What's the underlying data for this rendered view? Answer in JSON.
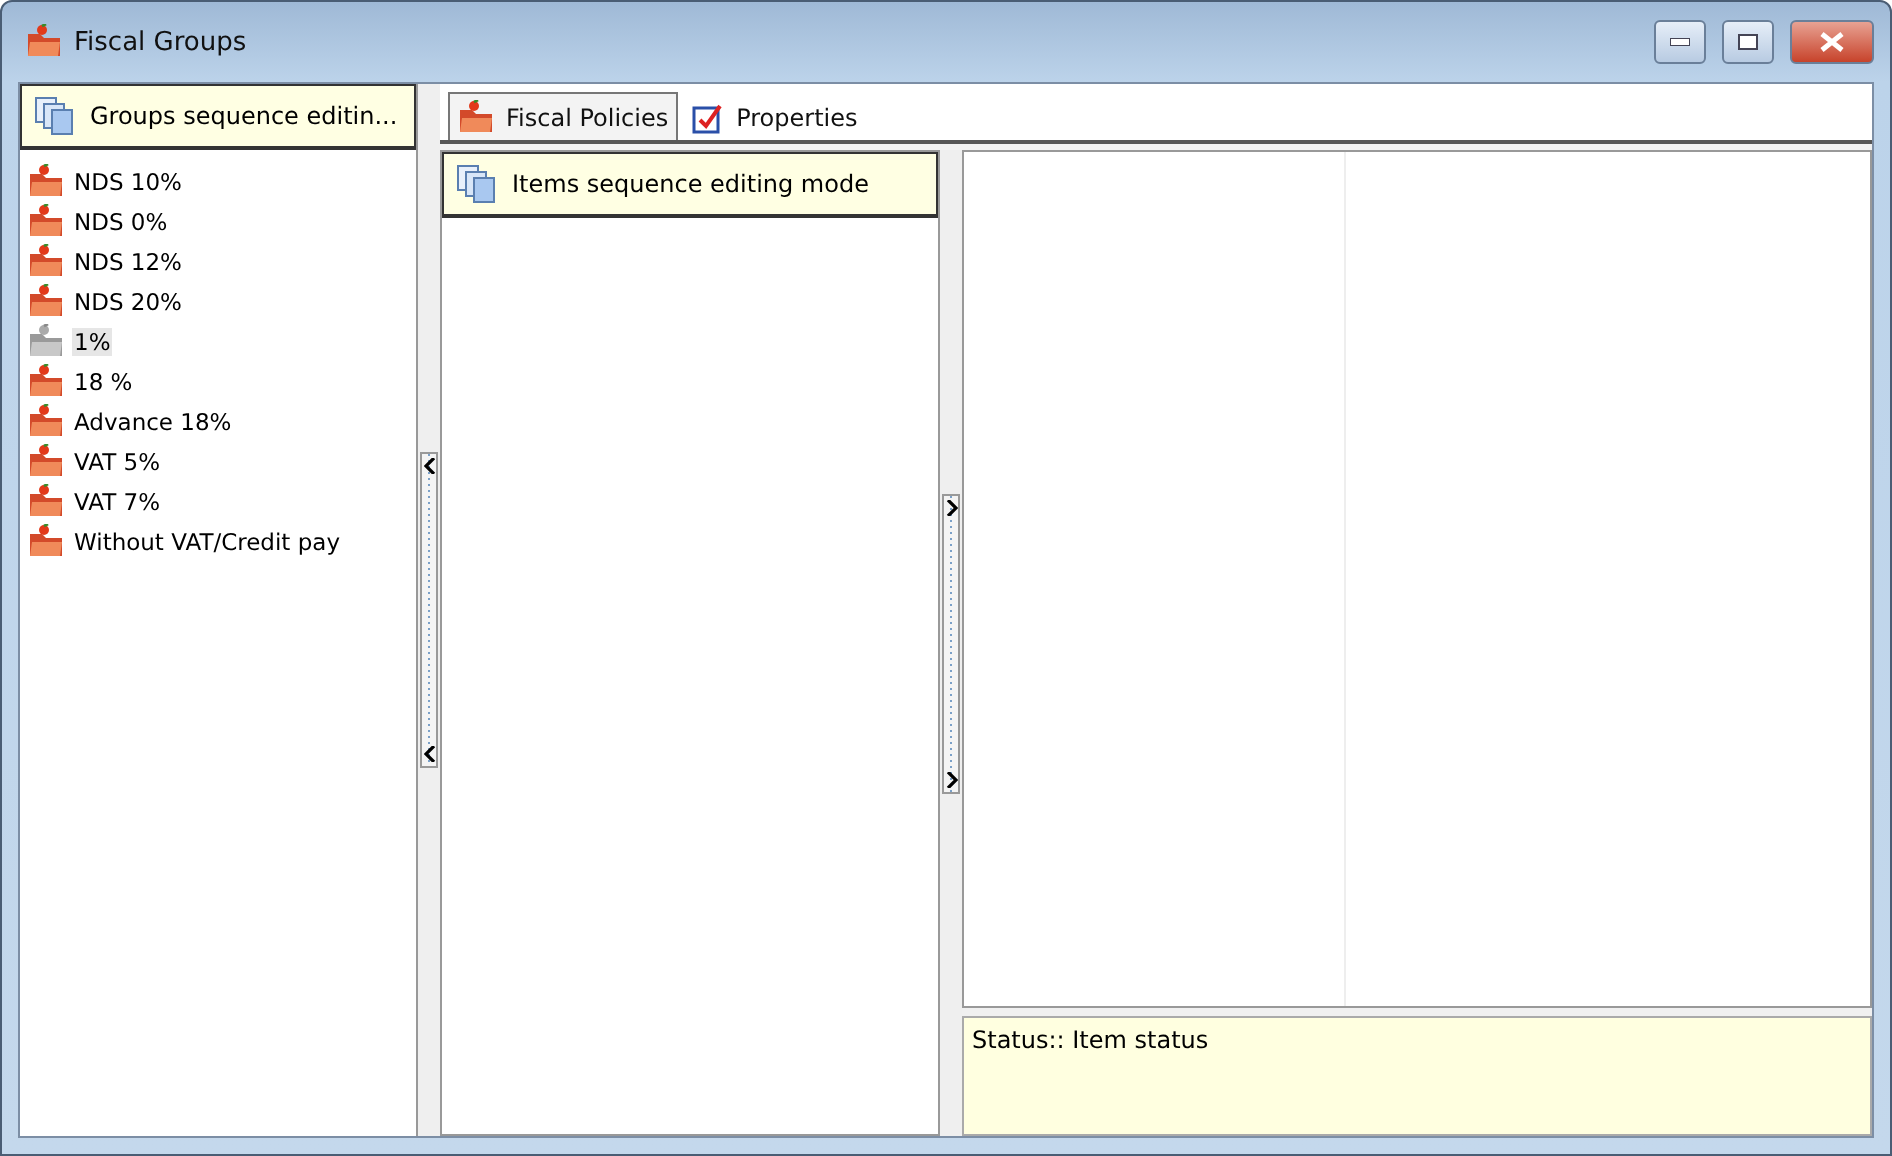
{
  "window": {
    "title": "Fiscal Groups"
  },
  "groups_panel": {
    "header": "Groups sequence editin...",
    "items": [
      {
        "label": "NDS 10%",
        "selected": false
      },
      {
        "label": "NDS 0%",
        "selected": false
      },
      {
        "label": "NDS 12%",
        "selected": false
      },
      {
        "label": "NDS 20%",
        "selected": false
      },
      {
        "label": "1%",
        "selected": true
      },
      {
        "label": "18 %",
        "selected": false
      },
      {
        "label": "Advance 18%",
        "selected": false
      },
      {
        "label": "VAT 5%",
        "selected": false
      },
      {
        "label": "VAT 7%",
        "selected": false
      },
      {
        "label": "Without VAT/Credit pay",
        "selected": false
      }
    ]
  },
  "tabs": [
    {
      "label": "Fiscal Policies",
      "kind": "policies",
      "selected": true
    },
    {
      "label": "Properties",
      "kind": "properties",
      "selected": false
    }
  ],
  "items_panel": {
    "header": "Items sequence editing mode"
  },
  "status": {
    "text": "Status:: Item status"
  }
}
